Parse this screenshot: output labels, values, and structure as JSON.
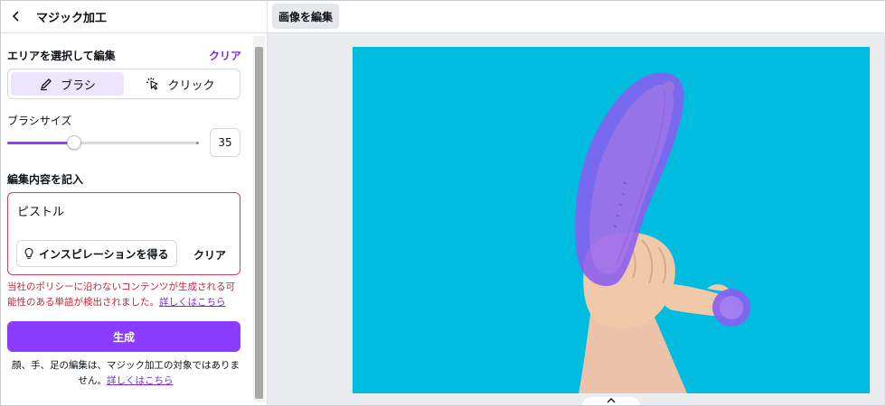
{
  "header": {
    "title": "マジック加工"
  },
  "area": {
    "section_title": "エリアを選択して編集",
    "clear": "クリア",
    "tools": [
      {
        "label": "ブラシ",
        "icon": "brush-icon",
        "active": true
      },
      {
        "label": "クリック",
        "icon": "click-select-icon",
        "active": false
      }
    ]
  },
  "brush_size": {
    "label": "ブラシサイズ",
    "value": "35",
    "fraction": 0.35
  },
  "prompt": {
    "label": "編集内容を記入",
    "value": "ピストル",
    "inspire": "インスピレーションを得る",
    "clear": "クリア"
  },
  "warning": {
    "text": "当社のポリシーに沿わないコンテンツが生成される可能性のある単語が検出されました。",
    "link": "詳しくはこちら"
  },
  "generate": "生成",
  "footnote": {
    "text": "顔、手、足の編集は、マジック加工の対象ではありません。",
    "link": "詳しくはこちら"
  },
  "editor": {
    "tab": "画像を編集"
  },
  "colors": {
    "accent": "#8b3dff",
    "error": "#c8233a",
    "canvas_bg": "#00bcdf"
  }
}
